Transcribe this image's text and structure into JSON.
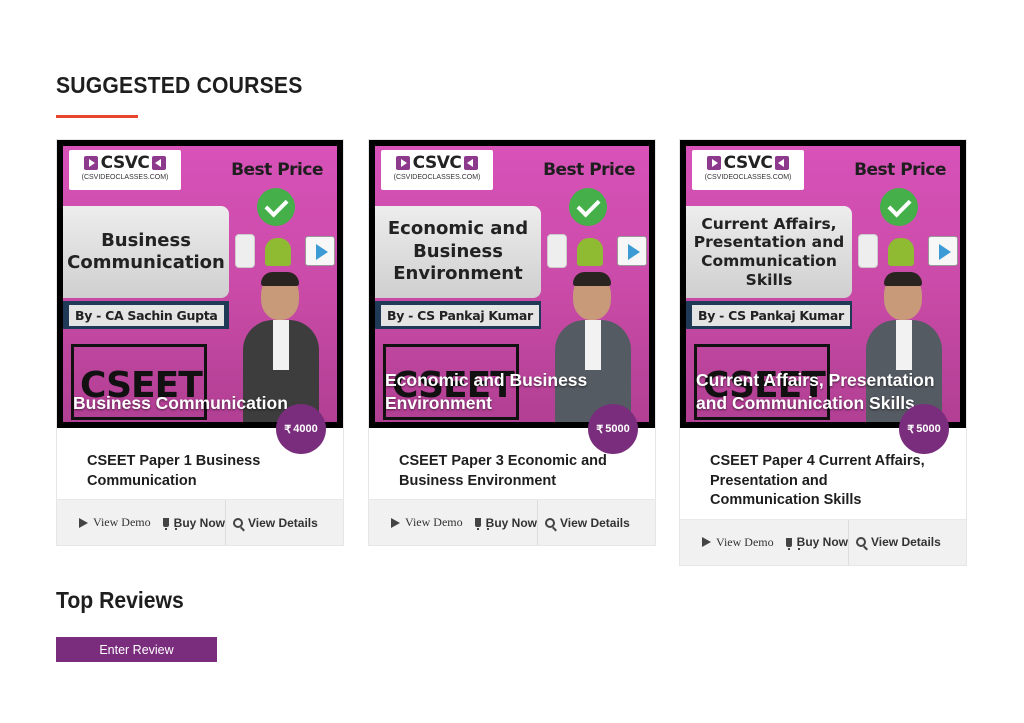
{
  "section_title": "SUGGESTED COURSES",
  "reviews_title": "Top Reviews",
  "enter_review_label": "Enter Review",
  "currency_symbol": "₹",
  "colors": {
    "accent_underline": "#e8452c",
    "brand_purple": "#7b2d7d",
    "thumb_pink": "#d852b9"
  },
  "thumb_common": {
    "logo_text": "CSVC",
    "logo_subtext": "(CSVIDEOCLASSES.COM)",
    "best_price": "Best Price",
    "cseet_text": "CSEET"
  },
  "footer_labels": {
    "demo": "View Demo",
    "buy": "Buy Now",
    "details": "View Details"
  },
  "courses": [
    {
      "thumb_title": "Business Communication",
      "byline": "By - CA Sachin Gupta",
      "overlay_title": "Business Communication",
      "price": "4000",
      "name": "CSEET Paper 1 Business Communication"
    },
    {
      "thumb_title": "Economic and Business Environment",
      "byline": "By - CS Pankaj Kumar",
      "overlay_title": "Economic and Business Environment",
      "price": "5000",
      "name": "CSEET Paper 3 Economic and Business Environment"
    },
    {
      "thumb_title": "Current Affairs, Presentation and Communication Skills",
      "byline": "By - CS Pankaj Kumar",
      "overlay_title": "Current Affairs, Presentation and Communication Skills",
      "price": "5000",
      "name": "CSEET Paper 4 Current Affairs, Presentation and Communication Skills"
    }
  ]
}
